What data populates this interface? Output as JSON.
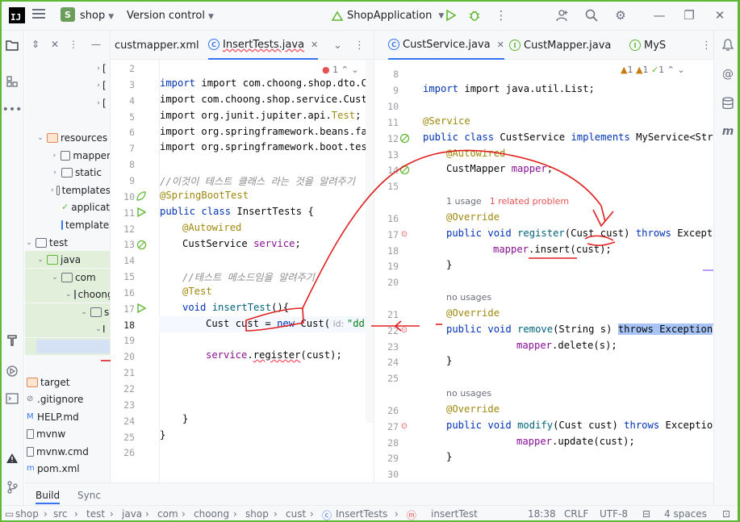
{
  "titlebar": {
    "project_badge": "S",
    "project_name": "shop",
    "version_control": "Version control",
    "run_config": "ShopApplication"
  },
  "colors": {
    "accent": "#3574f0",
    "green": "#5fb832",
    "error": "#e55353"
  },
  "tree": {
    "items": [
      {
        "label": ">",
        "indent": 3
      },
      {
        "label": ">",
        "indent": 3
      },
      {
        "label": ">",
        "indent": 3
      },
      {
        "label": "resources"
      },
      {
        "label": "mapper"
      },
      {
        "label": "static"
      },
      {
        "label": "templates"
      },
      {
        "label": "application"
      },
      {
        "label": "templates"
      },
      {
        "label": "test"
      },
      {
        "label": "java"
      },
      {
        "label": "com"
      },
      {
        "label": "choong"
      },
      {
        "label": "s"
      },
      {
        "label": "I"
      },
      {
        "label": "target"
      },
      {
        "label": ".gitignore"
      },
      {
        "label": "HELP.md"
      },
      {
        "label": "mvnw"
      },
      {
        "label": "mvnw.cmd"
      },
      {
        "label": "pom.xml"
      }
    ]
  },
  "left_editor": {
    "tabs": [
      {
        "label": "custmapper.xml"
      },
      {
        "label": "InsertTests.java"
      }
    ],
    "problems": "1",
    "lines": [
      {
        "n": "2"
      },
      {
        "n": "3"
      },
      {
        "n": "4"
      },
      {
        "n": "5"
      },
      {
        "n": "6"
      },
      {
        "n": "7"
      },
      {
        "n": "8"
      },
      {
        "n": "9"
      },
      {
        "n": "10"
      },
      {
        "n": "11"
      },
      {
        "n": "12"
      },
      {
        "n": "13"
      },
      {
        "n": "14"
      },
      {
        "n": "15"
      },
      {
        "n": "16"
      },
      {
        "n": "17"
      },
      {
        "n": "18"
      },
      {
        "n": "19"
      },
      {
        "n": "20"
      },
      {
        "n": "21"
      },
      {
        "n": "22"
      },
      {
        "n": "23"
      },
      {
        "n": "24"
      },
      {
        "n": "25"
      },
      {
        "n": "26"
      }
    ],
    "code": {
      "l3": "import com.choong.shop.dto.Cust;",
      "l4": "import com.choong.shop.service.CustSe",
      "l5a": "import org.junit.jupiter.api.",
      "l5b": "Test",
      "l5c": ";",
      "l6": "import org.springframework.beans.fact",
      "l7": "import org.springframework.boot.test.",
      "l9": "//이것이 테스트 클래스 라는 것을 알려주기",
      "l10": "@SpringBootTest",
      "l11a": "public class ",
      "l11b": "InsertTests {",
      "l12": "@Autowired",
      "l13a": "CustService ",
      "l13b": "service",
      "l13c": ";",
      "l15": "//테스트 메소드임을 알려주기",
      "l16": "@Test",
      "l17a": "void ",
      "l17b": "insertTest",
      "l17c": "(){",
      "l18a": "Cust ",
      "l18b": "cust",
      "l18c": " = ",
      "l18d": "new ",
      "l18e": "Cust(",
      "l18hint": " id: ",
      "l18f": "\"dd\"",
      "l20a": "service",
      "l20b": ".",
      "l20c": "register",
      "l20d": "(cust);",
      "l24": "}",
      "l25": "}"
    }
  },
  "right_editor": {
    "tabs": [
      {
        "label": "CustService.java"
      },
      {
        "label": "CustMapper.java"
      },
      {
        "label": "MyS"
      }
    ],
    "inspections": {
      "warn1": "1",
      "warn2": "1",
      "ok": "1"
    },
    "code": {
      "l9": "import java.util.List;",
      "l11": "@Service",
      "l12a": "public class ",
      "l12b": "CustService ",
      "l12c": "implements ",
      "l12d": "MyService<Stri",
      "l13": "@Autowired",
      "l14a": "CustMapper ",
      "l14b": "mapper",
      "l14c": ";",
      "usage1": "1 usage",
      "related": "1 related problem",
      "l16": "@Override",
      "l17a": "public void ",
      "l17b": "register",
      "l17c": "(Cust cust) ",
      "l17d": "throws ",
      "l17e": "Excepti",
      "l18a": "mapper",
      "l18b": ".insert(cust);",
      "l19": "}",
      "usage2": "no usages",
      "l21": "@Override",
      "l22a": "public void ",
      "l22b": "remove",
      "l22c": "(String s) ",
      "l22d": "throws Exception",
      "l23a": "mapper",
      "l23b": ".delete(s);",
      "l24": "}",
      "usage3": "no usages",
      "l26": "@Override",
      "l27a": "public void ",
      "l27b": "modify",
      "l27c": "(Cust cust) ",
      "l27d": "throws ",
      "l27e": "Exception",
      "l28a": "mapper",
      "l28b": ".update(cust);",
      "l29": "}"
    },
    "nums": [
      "8",
      "9",
      "10",
      "11",
      "12",
      "13",
      "14",
      "15",
      "16",
      "17",
      "18",
      "19",
      "20",
      "21",
      "22",
      "23",
      "24",
      "25",
      "26",
      "27",
      "28",
      "29",
      "30"
    ]
  },
  "bottom_tabs": {
    "build": "Build",
    "sync": "Sync"
  },
  "status": {
    "breadcrumb": [
      "shop",
      "src",
      "test",
      "java",
      "com",
      "choong",
      "shop",
      "cust",
      "InsertTests",
      "insertTest"
    ],
    "position": "18:38",
    "line_sep": "CRLF",
    "encoding": "UTF-8",
    "indent": "4 spaces"
  }
}
